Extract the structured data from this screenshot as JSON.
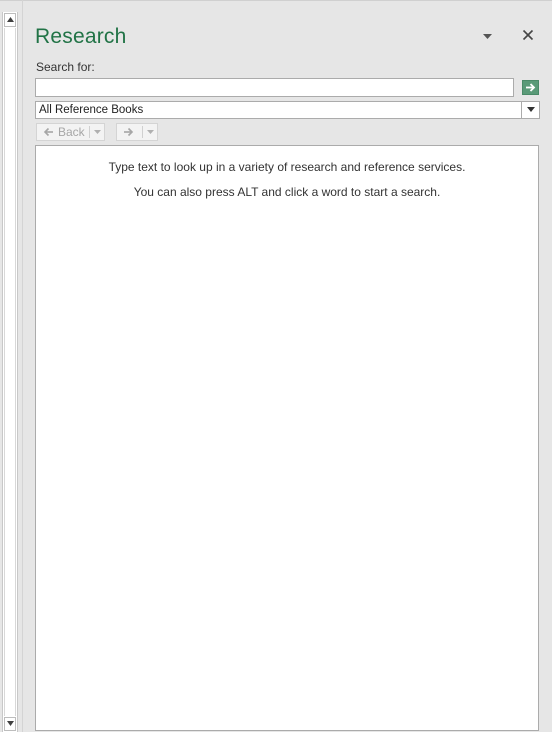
{
  "pane": {
    "title": "Research"
  },
  "search": {
    "label": "Search for:",
    "value": "",
    "placeholder": ""
  },
  "source": {
    "selected": "All Reference Books"
  },
  "nav": {
    "back_label": "Back"
  },
  "results": {
    "line1": "Type text to look up in a variety of research and reference services.",
    "line2": "You can also press ALT and click a word to start a search."
  },
  "colors": {
    "accent": "#217346",
    "go_button": "#5a9a78"
  },
  "icons": {
    "pane_options": "chevron-down-icon",
    "close": "close-icon",
    "go": "arrow-right-icon",
    "back": "arrow-left-icon",
    "forward": "arrow-right-icon"
  }
}
